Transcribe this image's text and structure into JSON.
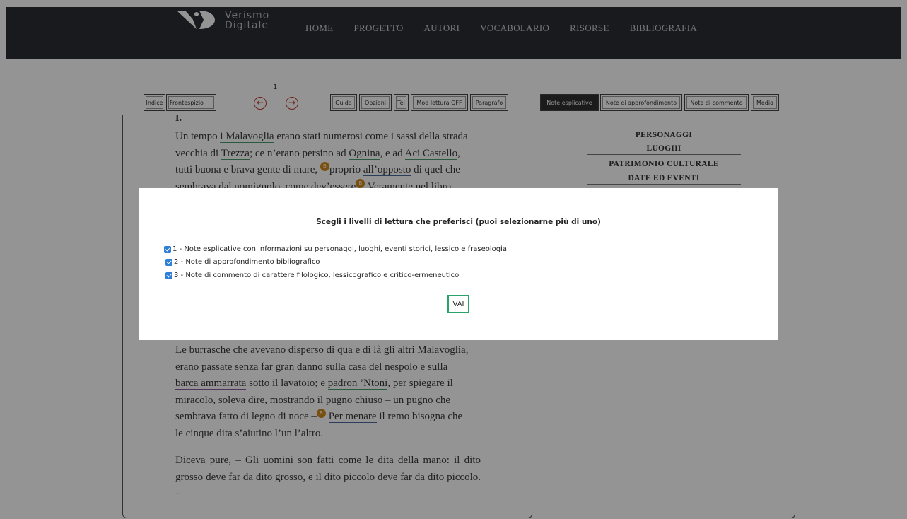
{
  "header": {
    "logo_line1": "Verismo",
    "logo_line2": "Digitale",
    "nav": [
      "HOME",
      "PROGETTO",
      "AUTORI",
      "VOCABOLARIO",
      "RISORSE",
      "BIBLIOGRAFIA"
    ]
  },
  "toolbar": {
    "page_number": "1",
    "indice": "Indice",
    "frontespizio": "Frontespizio",
    "prev_icon": "arrow-left-circle-icon",
    "next_icon": "arrow-right-circle-icon",
    "guida": "Guida",
    "opzioni": "Opzioni",
    "tei": "Tei",
    "mod_lettura": "Mod lettura OFF",
    "paragrafo": "Paragrafo"
  },
  "note_tabs": {
    "esplicative": "Note esplicative",
    "approfondimento": "Note di approfondimento",
    "commento": "Note di commento",
    "media": "Media"
  },
  "text": {
    "chapter": "I.",
    "p1_line1_a": "Un tempo ",
    "p1_malavoglia": "i Malavoglia",
    "p1_line1_b": " erano stati numerosi come i sassi della strada",
    "p1_line2_a": "vecchia di ",
    "p1_trezza": "Trezza",
    "p1_line2_b": "; ce n’erano persino ad ",
    "p1_ognina": "Ognina",
    "p1_line2_c": ", e ad ",
    "p1_aci": "Aci Castello",
    "p1_line2_d": ",",
    "p1_line3_a": "tutti buona e brava gente di mare, ",
    "p1_line3_b": "proprio ",
    "p1_opposto": "all’opposto",
    "p1_line3_c": " di quel che",
    "p1_line4": "sembrava dal nomignolo, come dev’essere",
    "p1_line4_b": " Veramente nel libro",
    "p2_line1_a": "Le burrasche che avevano disperso ",
    "p2_quala": "di qua e di là",
    "p2_line1_b": "  ",
    "p2_altri": "gli altri Malavoglia",
    "p2_line1_c": ",",
    "p2_line2_a": "erano passate senza far gran danno sulla ",
    "p2_casa": "casa del nespolo",
    "p2_line2_b": " e sulla",
    "p2_barca": "barca ammarrata",
    "p2_line3_b": " sotto il lavatoio; e ",
    "p2_padron": "padron ’Ntoni",
    "p2_line3_c": ", per spiegare il",
    "p2_line4": "miracolo, soleva dire, mostrando il pugno chiuso – un pugno che",
    "p2_line5_a": "sembrava fatto di legno di noce –",
    "p2_menare": "Per menare",
    "p2_line5_b": " il remo bisogna che",
    "p2_line6": "le cinque dita s’aiutino l’un l’altro.",
    "p3": "Diceva pure, – Gli uomini son fatti come le dita della mano: il dito grosso deve far da dito grosso, e il dito piccolo deve far da dito piccolo. –",
    "badge": "B"
  },
  "categories": [
    "PERSONAGGI",
    "LUOGHI",
    "PATRIMONIO CULTURALE",
    "DATE ED EVENTI"
  ],
  "modal": {
    "title": "Scegli i livelli di lettura che preferisci (puoi selezionarne più di uno)",
    "options": [
      {
        "label": "1 - Note esplicative con informazioni su personaggi, luoghi, eventi storici, lessico e fraseologia",
        "checked": true
      },
      {
        "label": "2 - Note di approfondimento bibliografico",
        "checked": true
      },
      {
        "label": "3 - Note di commento di carattere filologico, lessicografico e critico-ermeneutico",
        "checked": true
      }
    ],
    "button": "VAI"
  },
  "colors": {
    "header_bg": "#2b2e33",
    "accent_red": "#c0392b",
    "checkbox_blue": "#2f7fd8",
    "vai_border": "#2aa36a",
    "badge_orange": "#d08a1a"
  }
}
